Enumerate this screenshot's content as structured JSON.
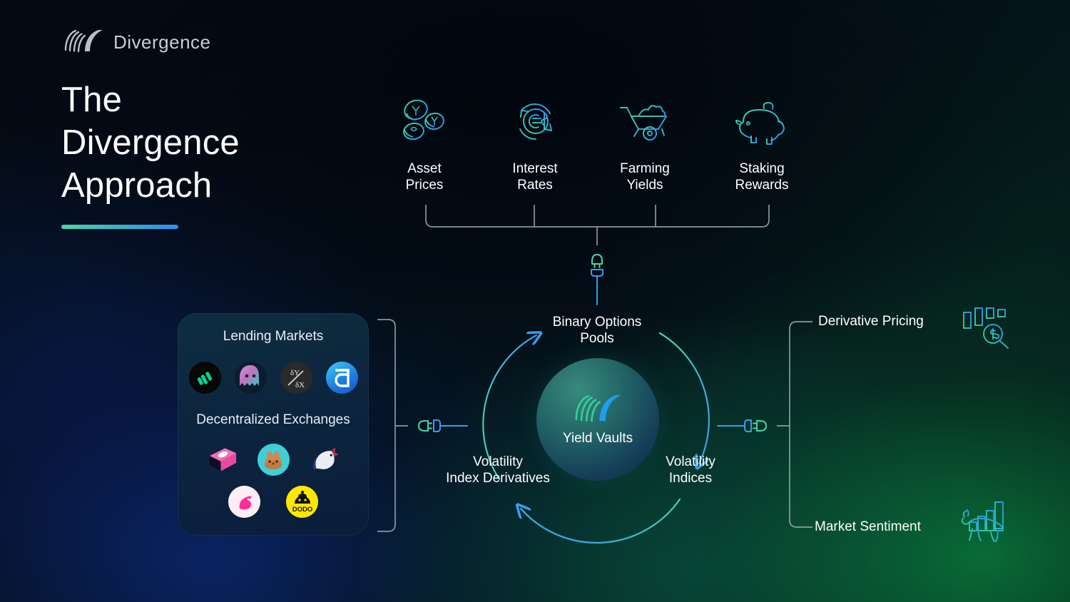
{
  "brand": {
    "name": "Divergence",
    "logo_icon": "divergence-logo-mark"
  },
  "heading": {
    "line1": "The",
    "line2": "Divergence",
    "line3": "Approach"
  },
  "sources": {
    "items": [
      {
        "label_line1": "Asset",
        "label_line2": "Prices",
        "icon": "coins-icon"
      },
      {
        "label_line1": "Interest",
        "label_line2": "Rates",
        "icon": "currency-exchange-icon"
      },
      {
        "label_line1": "Farming",
        "label_line2": "Yields",
        "icon": "wheelbarrow-icon"
      },
      {
        "label_line1": "Staking",
        "label_line2": "Rewards",
        "icon": "piggy-bank-icon"
      }
    ]
  },
  "hub": {
    "label": "Yield Vaults",
    "logo_icon": "divergence-logo-mark"
  },
  "cycle": {
    "top": "Binary Options\nPools",
    "top_line1": "Binary Options",
    "top_line2": "Pools",
    "right_line1": "Volatility",
    "right_line2": "Indices",
    "left_line1": "Volatility",
    "left_line2": "Index Derivatives"
  },
  "sources_card": {
    "lending_title": "Lending Markets",
    "lending_logos": [
      {
        "name": "compound-logo"
      },
      {
        "name": "aave-logo"
      },
      {
        "name": "curve-logo"
      },
      {
        "name": "dforce-logo"
      }
    ],
    "dex_title": "Decentralized Exchanges",
    "dex_logos_row1": [
      {
        "name": "sushiswap-logo"
      },
      {
        "name": "pancakeswap-logo"
      },
      {
        "name": "1inch-logo"
      }
    ],
    "dex_logos_row2": [
      {
        "name": "uniswap-logo"
      },
      {
        "name": "dodo-logo"
      }
    ]
  },
  "outputs": {
    "items": [
      {
        "label": "Derivative Pricing",
        "icon": "candlestick-magnifier-icon"
      },
      {
        "label": "Market Sentiment",
        "icon": "bull-bar-chart-icon"
      }
    ]
  },
  "connectors": {
    "top": "plug-socket-vertical-icon",
    "left": "plug-socket-left-icon",
    "right": "plug-socket-right-icon"
  },
  "colors": {
    "accent_green": "#4fd2a8",
    "accent_blue": "#2a8ef0",
    "text": "#ffffff",
    "bracket": "#9fb0b6"
  }
}
